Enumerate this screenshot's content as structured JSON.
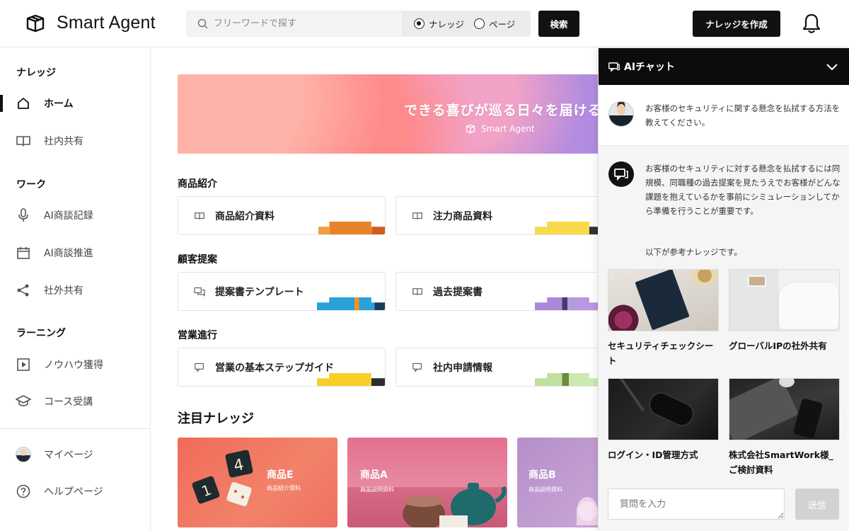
{
  "header": {
    "app_name": "Smart Agent",
    "search_placeholder": "フリーワードで探す",
    "radio_knowledge": "ナレッジ",
    "radio_page": "ページ",
    "search_button": "検索",
    "create_button": "ナレッジを作成"
  },
  "sidebar": {
    "section_knowledge": "ナレッジ",
    "home": "ホーム",
    "internal_share": "社内共有",
    "section_work": "ワーク",
    "ai_meeting_record": "AI商談記録",
    "ai_meeting_promo": "AI商談推進",
    "external_share": "社外共有",
    "section_learning": "ラーニング",
    "knowhow": "ノウハウ獲得",
    "course": "コース受講",
    "mypage": "マイページ",
    "help": "ヘルプページ"
  },
  "main": {
    "banner_text": "できる喜びが巡る日々を届ける",
    "banner_brand": "Smart Agent",
    "categories": [
      {
        "title": "商品紹介",
        "cards": [
          "商品紹介資料",
          "注力商品資料"
        ]
      },
      {
        "title": "顧客提案",
        "cards": [
          "提案書テンプレート",
          "過去提案書"
        ]
      },
      {
        "title": "営業進行",
        "cards": [
          "営業の基本ステップガイド",
          "社内申請情報"
        ]
      }
    ],
    "featured_title": "注目ナレッジ",
    "featured": [
      {
        "title": "商品E",
        "subtitle": "商品紹介資料"
      },
      {
        "title": "商品A",
        "subtitle": "商品説明資料"
      },
      {
        "title": "商品B",
        "subtitle": "商品説明資料"
      }
    ]
  },
  "chat": {
    "title": "AIチャット",
    "user_message": "お客様のセキュリティに関する懸念を払拭する方法を教えてください。",
    "bot_message": "お客様のセキュリティに対する懸念を払拭するには同規模、同職種の過去提案を見たうえでお客様がどんな課題を抱えているかを事前にシミュレーションしてから準備を行うことが重要です。",
    "ref_intro": "以下が参考ナレッジです。",
    "refs": [
      {
        "label": "セキュリティチェックシート"
      },
      {
        "label": "グローバルIPの社外共有"
      },
      {
        "label": "ログイン・ID管理方式"
      },
      {
        "label": "株式会社SmartWork様_ご検討資料"
      }
    ],
    "input_placeholder": "質問を入力",
    "send_button": "送信"
  },
  "colors": {
    "primary": "#111111",
    "chat_header": "#0c0c0c",
    "disabled_button": "#d2d2d2"
  }
}
